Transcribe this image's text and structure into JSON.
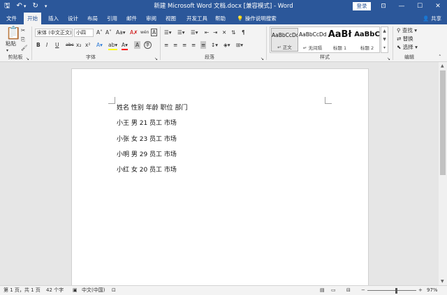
{
  "title": "新建 Microsoft Word 文档.docx [兼容模式] - Word",
  "login_label": "登录",
  "qat": {
    "save": "🖫",
    "undo": "↶",
    "undo_dd": "▾",
    "redo": "↻",
    "customize": "▾"
  },
  "window": {
    "restore_ribbon": "⊡",
    "minimize": "—",
    "maximize": "☐",
    "close": "✕"
  },
  "tabs": [
    "文件",
    "开始",
    "插入",
    "设计",
    "布局",
    "引用",
    "邮件",
    "审阅",
    "视图",
    "开发工具",
    "帮助"
  ],
  "tell_me": "操作说明搜索",
  "share": "共享",
  "clipboard": {
    "paste": "粘贴",
    "cut": "✂",
    "copy": "⎘",
    "format_painter": "🖌",
    "label": "剪贴板"
  },
  "font": {
    "family": "宋体 (中文正文)",
    "size": "小四",
    "grow": "A˄",
    "shrink": "A˅",
    "case": "Aa▾",
    "clear": "A✗",
    "phonetic": "wén",
    "border_char": "A",
    "bold": "B",
    "italic": "I",
    "underline": "U",
    "strike": "abc",
    "sub": "x₂",
    "sup": "x²",
    "effects": "A▾",
    "highlight": "ab▾",
    "color": "A▾",
    "shade": "A",
    "circle": "字",
    "label": "字体"
  },
  "paragraph": {
    "label": "段落"
  },
  "styles": {
    "label": "样式",
    "items": [
      {
        "sample": "AaBbCcDd",
        "name": "↵ 正文"
      },
      {
        "sample": "AaBbCcDd",
        "name": "↵ 无间隔"
      },
      {
        "sample": "AaBł",
        "name": "标题 1"
      },
      {
        "sample": "AaBbC",
        "name": "标题 2"
      }
    ]
  },
  "editing": {
    "label": "编辑",
    "find": "查找 ▾",
    "replace": "替换",
    "select": "选择 ▾"
  },
  "document": {
    "lines": [
      "姓名 性别 年龄 职位 部门",
      "小王 男 21 员工 市场",
      "小张 女 23 员工 市场",
      "小明 男 29 员工 市场",
      "小红 女 20 员工 市场"
    ]
  },
  "status": {
    "page": "第 1 页，共 1 页",
    "words": "42 个字",
    "lang": "中文(中国)",
    "zoom": "97%",
    "zoom_minus": "−",
    "zoom_plus": "+"
  },
  "colors": {
    "brand": "#2b579a",
    "highlight": "#ffff00",
    "font_color": "#ff0000"
  }
}
